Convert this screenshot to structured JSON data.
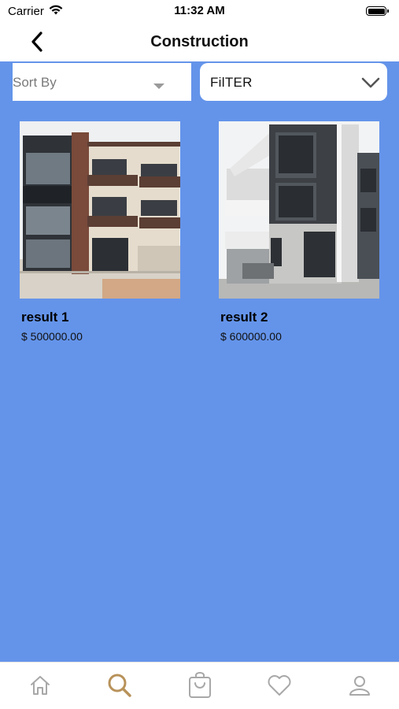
{
  "status_bar": {
    "carrier": "Carrier",
    "time": "11:32 AM"
  },
  "nav": {
    "title": "Construction",
    "back_icon": "chevron-left-icon"
  },
  "controls": {
    "sort_label": "Sort By",
    "filter_label": "FilTER"
  },
  "results": [
    {
      "title": "result 1",
      "price": "$ 500000.00"
    },
    {
      "title": "result 2",
      "price": "$ 600000.00"
    }
  ],
  "tab_bar": {
    "items": [
      {
        "icon": "home-icon",
        "active": false
      },
      {
        "icon": "search-icon",
        "active": true
      },
      {
        "icon": "cart-icon",
        "active": false
      },
      {
        "icon": "heart-icon",
        "active": false
      },
      {
        "icon": "profile-icon",
        "active": false
      }
    ]
  },
  "colors": {
    "main_background": "#6494ea",
    "tab_active": "#b8925a",
    "tab_inactive": "#a8a8a8"
  }
}
